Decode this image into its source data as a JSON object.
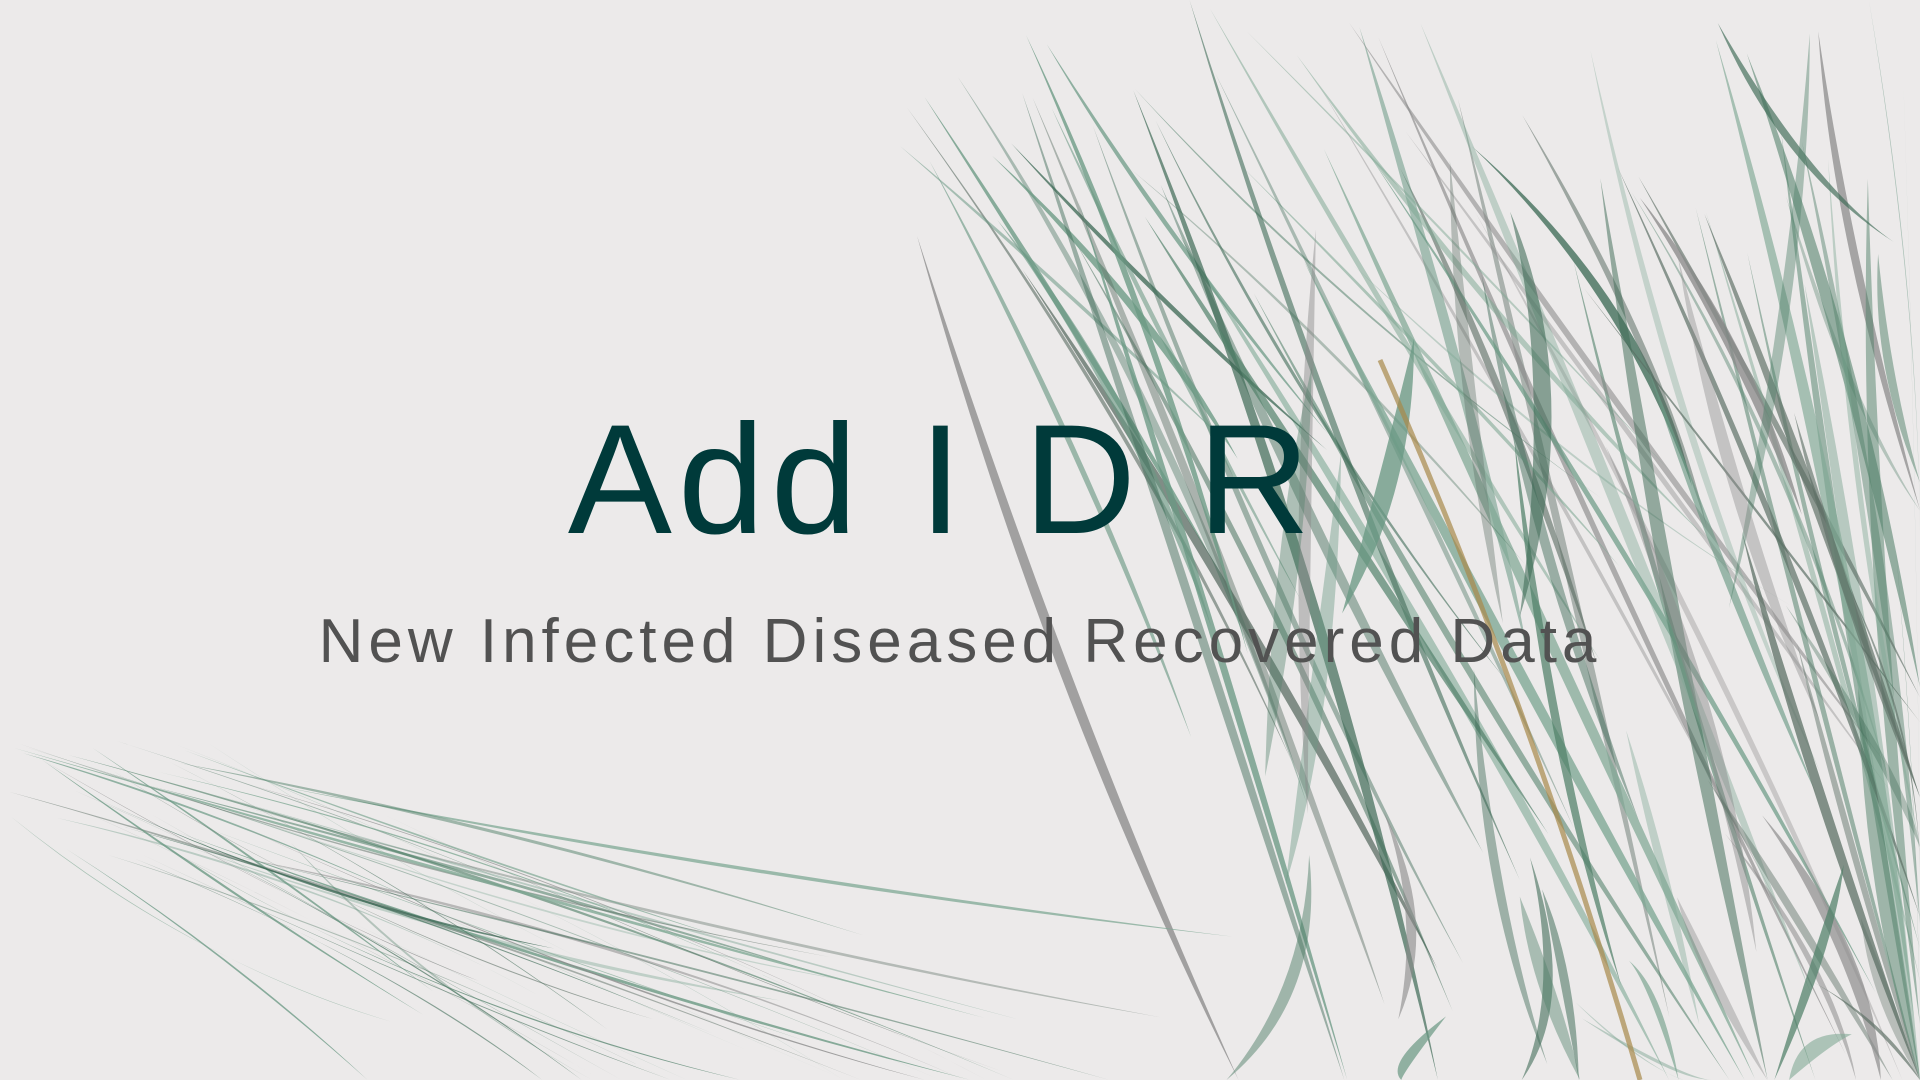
{
  "slide": {
    "title": "Add I D R",
    "subtitle": "New Infected Diseased Recovered Data"
  },
  "colors": {
    "background": "#eceaea",
    "title": "#003a3a",
    "subtitle": "#525252",
    "leaf": "#5f8f78"
  },
  "background_image": "palm-leaves"
}
